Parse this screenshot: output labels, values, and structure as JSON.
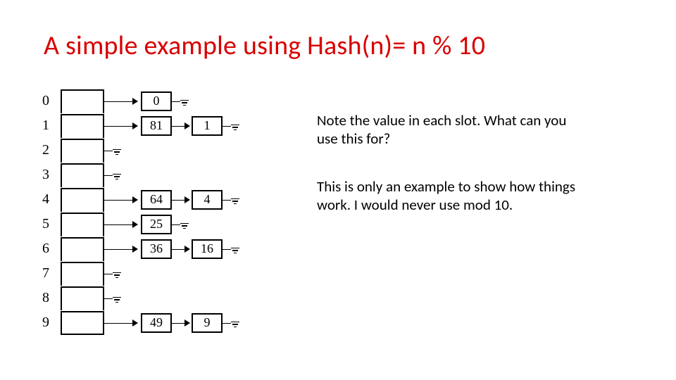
{
  "title": "A simple example using Hash(n)= n % 10",
  "paragraphs": {
    "p1": "Note the value in each slot.  What can you use this for?",
    "p2": "This is only an example to show how things work.  I would never use mod 10."
  },
  "hash_table": {
    "indices": [
      "0",
      "1",
      "2",
      "3",
      "4",
      "5",
      "6",
      "7",
      "8",
      "9"
    ],
    "rows": [
      {
        "index": "0",
        "chain": [
          "0"
        ]
      },
      {
        "index": "1",
        "chain": [
          "81",
          "1"
        ]
      },
      {
        "index": "2",
        "chain": []
      },
      {
        "index": "3",
        "chain": []
      },
      {
        "index": "4",
        "chain": [
          "64",
          "4"
        ]
      },
      {
        "index": "5",
        "chain": [
          "25"
        ]
      },
      {
        "index": "6",
        "chain": [
          "36",
          "16"
        ]
      },
      {
        "index": "7",
        "chain": []
      },
      {
        "index": "8",
        "chain": []
      },
      {
        "index": "9",
        "chain": [
          "49",
          "9"
        ]
      }
    ]
  }
}
